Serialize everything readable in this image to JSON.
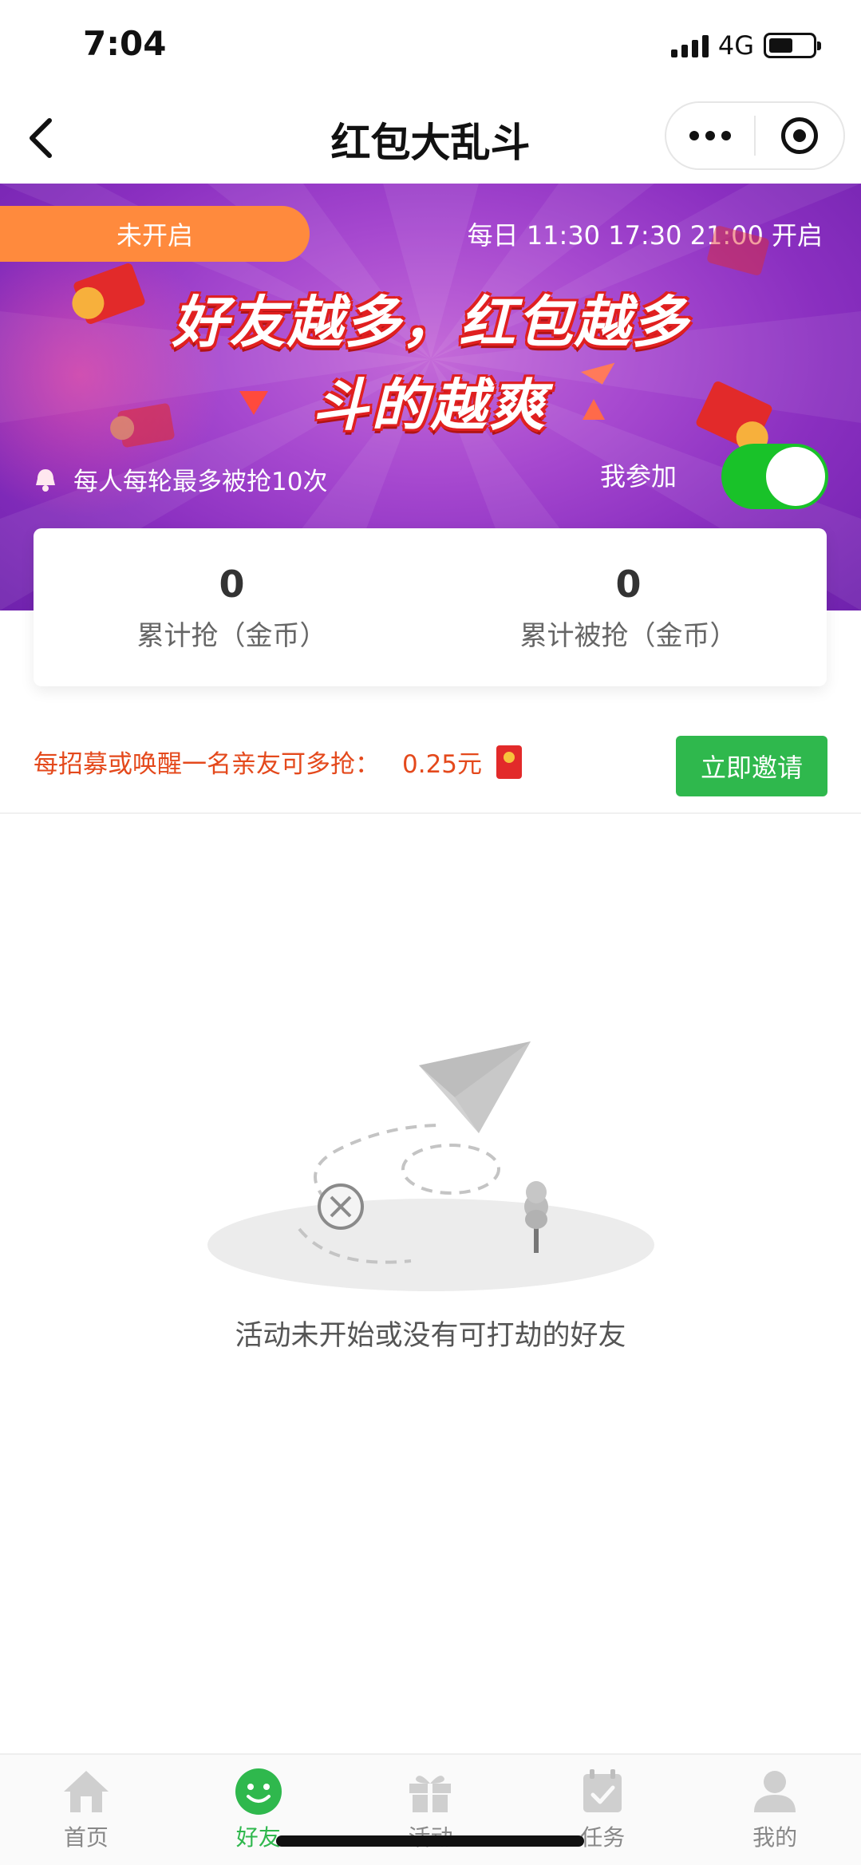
{
  "status_bar": {
    "time": "7:04",
    "network": "4G",
    "battery_level": 0.55
  },
  "nav": {
    "title": "红包大乱斗"
  },
  "banner": {
    "status": "未开启",
    "schedule": "每日 11:30 17:30 21:00 开启",
    "slogan_line1": "好友越多，红包越多",
    "slogan_line2": "斗的越爽",
    "rule": "每人每轮最多被抢10次",
    "join_label": "我参加",
    "join_enabled": true
  },
  "stats": {
    "grabbed_value": "0",
    "grabbed_label": "累计抢（金币）",
    "robbed_value": "0",
    "robbed_label": "累计被抢（金币）"
  },
  "invite": {
    "text": "每招募或唤醒一名亲友可多抢：",
    "amount": "0.25元",
    "button": "立即邀请"
  },
  "empty_state": {
    "text": "活动未开始或没有可打劫的好友"
  },
  "tab_bar": {
    "items": [
      {
        "label": "首页",
        "icon": "home-icon",
        "active": false
      },
      {
        "label": "好友",
        "icon": "smile-icon",
        "active": true
      },
      {
        "label": "活动",
        "icon": "gift-icon",
        "active": false
      },
      {
        "label": "任务",
        "icon": "calendar-check-icon",
        "active": false
      },
      {
        "label": "我的",
        "icon": "user-icon",
        "active": false
      }
    ],
    "active_color": "#2fb84d",
    "inactive_color": "#888888"
  },
  "colors": {
    "banner_purple": "#a648cf",
    "status_orange": "#ff8a3d",
    "toggle_green": "#19c229",
    "invite_red": "#e4491c",
    "button_green": "#2fb84d"
  }
}
